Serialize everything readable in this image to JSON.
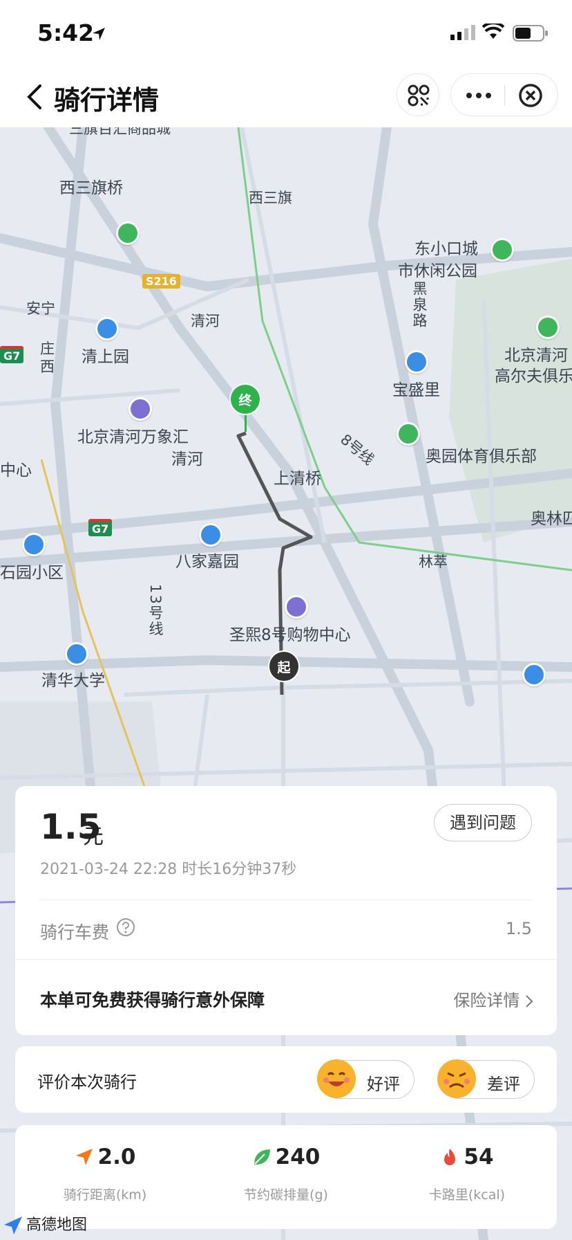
{
  "status_bar": {
    "time": "5:42"
  },
  "nav": {
    "title": "骑行详情"
  },
  "map": {
    "labels": {
      "xisanqi_bridge": "西三旗桥",
      "xisanqi": "西三旗",
      "dongxiaokou_1": "东小口城",
      "dongxiaokou_2": "市休闲公园",
      "anning_1": "安宁",
      "anning_2": "庄",
      "anning_3": "西",
      "heiquan": "黑泉路",
      "qinghe_1": "清河",
      "qingshangyuan": "清上园",
      "beijing_golf_1": "北京清河",
      "beijing_golf_2": "高尔夫俱乐",
      "baoshengli": "宝盛里",
      "wanxianghui": "北京清河万象汇",
      "qinghe_2": "清河",
      "line8": "8号线",
      "aoyuan": "奥园体育俱乐部",
      "zhongxin": "中心",
      "shangqing_bridge": "上清桥",
      "aolin": "奥林匹",
      "bajiajiayuan": "八家嘉园",
      "linyuan": "林萃",
      "shigeyuan": "石园小区",
      "line13": "13号线",
      "shengxi": "圣熙8号购物中心",
      "tsinghua": "清华大学",
      "shangpin": "三旗百汇商品城",
      "shield_s216": "S216",
      "shield_g7a": "G7",
      "shield_g7b": "G7",
      "marker_end": "终",
      "marker_start": "起"
    }
  },
  "fare_card": {
    "price": "1.5",
    "unit": "元",
    "issue_button": "遇到问题",
    "ride_info": "2021-03-24 22:28 时长16分钟37秒",
    "fee_label": "骑行车费",
    "fee_value": "1.5",
    "insurance_text": "本单可免费获得骑行意外保障",
    "insurance_link": "保险详情"
  },
  "rate_card": {
    "label": "评价本次骑行",
    "good": "好评",
    "bad": "差评"
  },
  "stats": {
    "distance_value": "2.0",
    "distance_label": "骑行距离(km)",
    "carbon_value": "240",
    "carbon_label": "节约碳排量(g)",
    "calorie_value": "54",
    "calorie_label": "卡路里(kcal)"
  },
  "footer": {
    "brand": "高德地图"
  },
  "colors": {
    "map_bg": "#e7ebf1",
    "road": "#c9d1dc",
    "route": "#555555",
    "end_marker": "#2eb34c",
    "poi_blue": "#3a8ee6"
  }
}
